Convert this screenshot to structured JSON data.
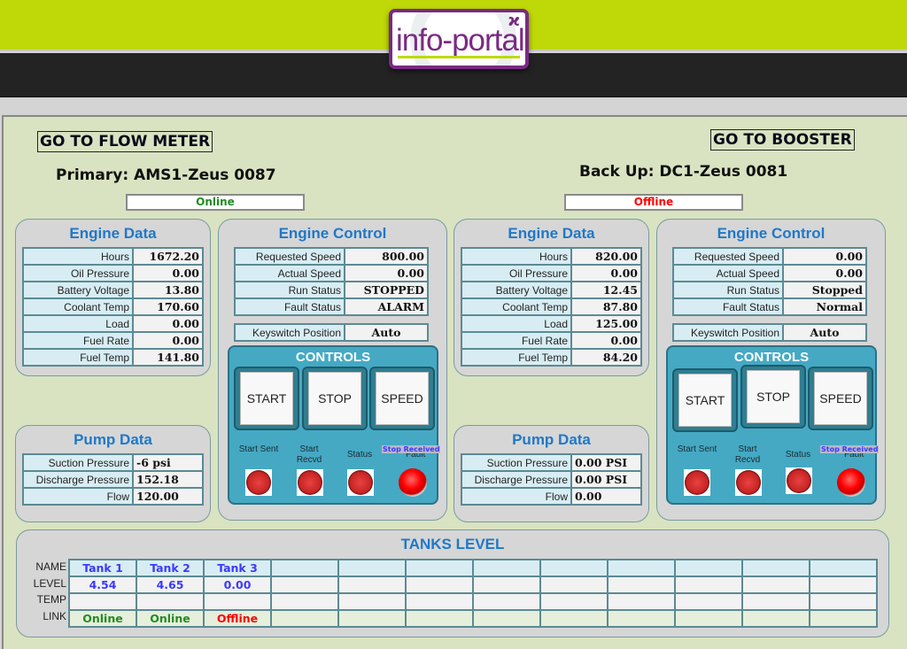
{
  "header": {
    "logo_text": "info-portal",
    "accent_color": "#bfd807",
    "brand_color": "#7a2a84"
  },
  "nav": {
    "flow_meter_button": "GO TO FLOW METER",
    "booster_button": "GO TO BOOSTER"
  },
  "primary": {
    "title": "Primary: AMS1-Zeus 0087",
    "status": "Online",
    "status_color": "#228b22",
    "engine_data": {
      "title": "Engine Data",
      "rows": [
        {
          "label": "Hours",
          "value": "1672.20"
        },
        {
          "label": "Oil Pressure",
          "value": "0.00"
        },
        {
          "label": "Battery Voltage",
          "value": "13.80"
        },
        {
          "label": "Coolant Temp",
          "value": "170.60"
        },
        {
          "label": "Load",
          "value": "0.00"
        },
        {
          "label": "Fuel Rate",
          "value": "0.00"
        },
        {
          "label": "Fuel Temp",
          "value": "141.80"
        }
      ]
    },
    "engine_control": {
      "title": "Engine Control",
      "rows": [
        {
          "label": "Requested Speed",
          "value": "800.00"
        },
        {
          "label": "Actual Speed",
          "value": "0.00"
        },
        {
          "label": "Run Status",
          "value": "STOPPED"
        },
        {
          "label": "Fault Status",
          "value": "ALARM"
        }
      ],
      "keyswitch": {
        "label": "Keyswitch Position",
        "value": "Auto"
      }
    },
    "controls": {
      "title": "CONTROLS",
      "buttons": [
        "START",
        "STOP",
        "SPEED"
      ],
      "indicators": [
        {
          "label": "Start Sent"
        },
        {
          "label": "Start Recvd"
        },
        {
          "label": "Status"
        }
      ],
      "fault_label": "Fault",
      "fault_message": "Stop Received"
    },
    "pump_data": {
      "title": "Pump Data",
      "rows": [
        {
          "label": "Suction Pressure",
          "value": "-6 psi"
        },
        {
          "label": "Discharge Pressure",
          "value": "152.18"
        },
        {
          "label": "Flow",
          "value": "120.00"
        }
      ]
    }
  },
  "backup": {
    "title": "Back Up: DC1-Zeus 0081",
    "status": "Offline",
    "status_color": "#ff0000",
    "engine_data": {
      "title": "Engine Data",
      "rows": [
        {
          "label": "Hours",
          "value": "820.00"
        },
        {
          "label": "Oil Pressure",
          "value": "0.00"
        },
        {
          "label": "Battery Voltage",
          "value": "12.45"
        },
        {
          "label": "Coolant Temp",
          "value": "87.80"
        },
        {
          "label": "Load",
          "value": "125.00"
        },
        {
          "label": "Fuel Rate",
          "value": "0.00"
        },
        {
          "label": "Fuel Temp",
          "value": "84.20"
        }
      ]
    },
    "engine_control": {
      "title": "Engine Control",
      "rows": [
        {
          "label": "Requested Speed",
          "value": "0.00"
        },
        {
          "label": "Actual Speed",
          "value": "0.00"
        },
        {
          "label": "Run Status",
          "value": "Stopped"
        },
        {
          "label": "Fault Status",
          "value": "Normal"
        }
      ],
      "keyswitch": {
        "label": "Keyswitch Position",
        "value": "Auto"
      }
    },
    "controls": {
      "title": "CONTROLS",
      "buttons": [
        "START",
        "STOP",
        "SPEED"
      ],
      "indicators": [
        {
          "label": "Start Sent"
        },
        {
          "label": "Start Recvd"
        },
        {
          "label": "Status"
        }
      ],
      "fault_label": "Fault",
      "fault_message": "Stop Received"
    },
    "pump_data": {
      "title": "Pump Data",
      "rows": [
        {
          "label": "Suction Pressure",
          "value": "0.00 PSI"
        },
        {
          "label": "Discharge Pressure",
          "value": "0.00 PSI"
        },
        {
          "label": "Flow",
          "value": "0.00"
        }
      ]
    }
  },
  "tanks": {
    "title": "TANKS LEVEL",
    "row_labels": [
      "NAME",
      "LEVEL",
      "TEMP",
      "LINK"
    ],
    "columns": [
      {
        "name": "Tank 1",
        "level": "4.54",
        "temp": "",
        "link": "Online",
        "link_color": "#228b22"
      },
      {
        "name": "Tank 2",
        "level": "4.65",
        "temp": "",
        "link": "Online",
        "link_color": "#228b22"
      },
      {
        "name": "Tank 3",
        "level": "0.00",
        "temp": "",
        "link": "Offline",
        "link_color": "#ff0000"
      },
      {
        "name": "",
        "level": "",
        "temp": "",
        "link": ""
      },
      {
        "name": "",
        "level": "",
        "temp": "",
        "link": ""
      },
      {
        "name": "",
        "level": "",
        "temp": "",
        "link": ""
      },
      {
        "name": "",
        "level": "",
        "temp": "",
        "link": ""
      },
      {
        "name": "",
        "level": "",
        "temp": "",
        "link": ""
      },
      {
        "name": "",
        "level": "",
        "temp": "",
        "link": ""
      },
      {
        "name": "",
        "level": "",
        "temp": "",
        "link": ""
      },
      {
        "name": "",
        "level": "",
        "temp": "",
        "link": ""
      },
      {
        "name": "",
        "level": "",
        "temp": "",
        "link": ""
      }
    ]
  }
}
